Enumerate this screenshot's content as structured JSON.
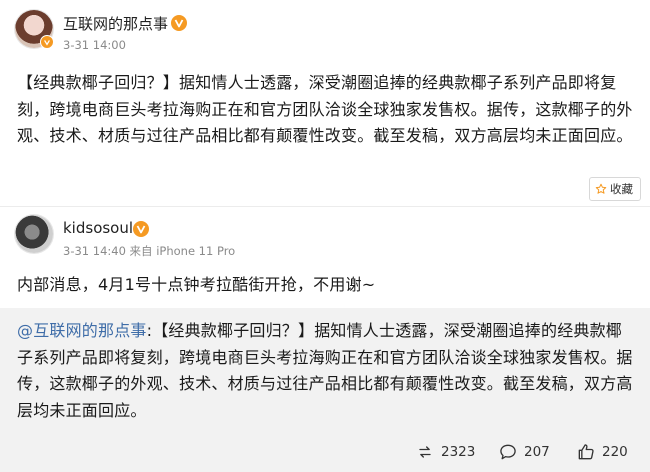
{
  "post1": {
    "author": "互联网的那点事",
    "time": "3-31 14:00",
    "text": "【经典款椰子回归？】据知情人士透露，深受潮圈追捧的经典款椰子系列产品即将复刻，跨境电商巨头考拉海购正在和官方团队洽谈全球独家发售权。据传，这款椰子的外观、技术、材质与过往产品相比都有颠覆性改变。截至发稿，双方高层均未正面回应。",
    "favorite_label": "收藏"
  },
  "post2": {
    "author": "kidsosoul",
    "time": "3-31 14:40 来自 iPhone 11 Pro",
    "text": "内部消息，4月1号十点钟考拉酷街开抢，不用谢~",
    "repost": {
      "mention": "@互联网的那点事",
      "text": ":【经典款椰子回归？】据知情人士透露，深受潮圈追捧的经典款椰子系列产品即将复刻，跨境电商巨头考拉海购正在和官方团队洽谈全球独家发售权。据传，这款椰子的外观、技术、材质与过往产品相比都有颠覆性改变。截至发稿，双方高层均未正面回应。",
      "reposts": "2323",
      "comments": "207",
      "likes": "220"
    }
  },
  "icons": {
    "verified_badge": "orange-v-badge-icon",
    "favorite": "star-icon",
    "repost": "repost-icon",
    "comment": "comment-icon",
    "like": "thumbs-up-icon"
  },
  "colors": {
    "mention": "#3f6da8",
    "badge": "#f59a23",
    "repost_bg": "#f2f2f2"
  }
}
